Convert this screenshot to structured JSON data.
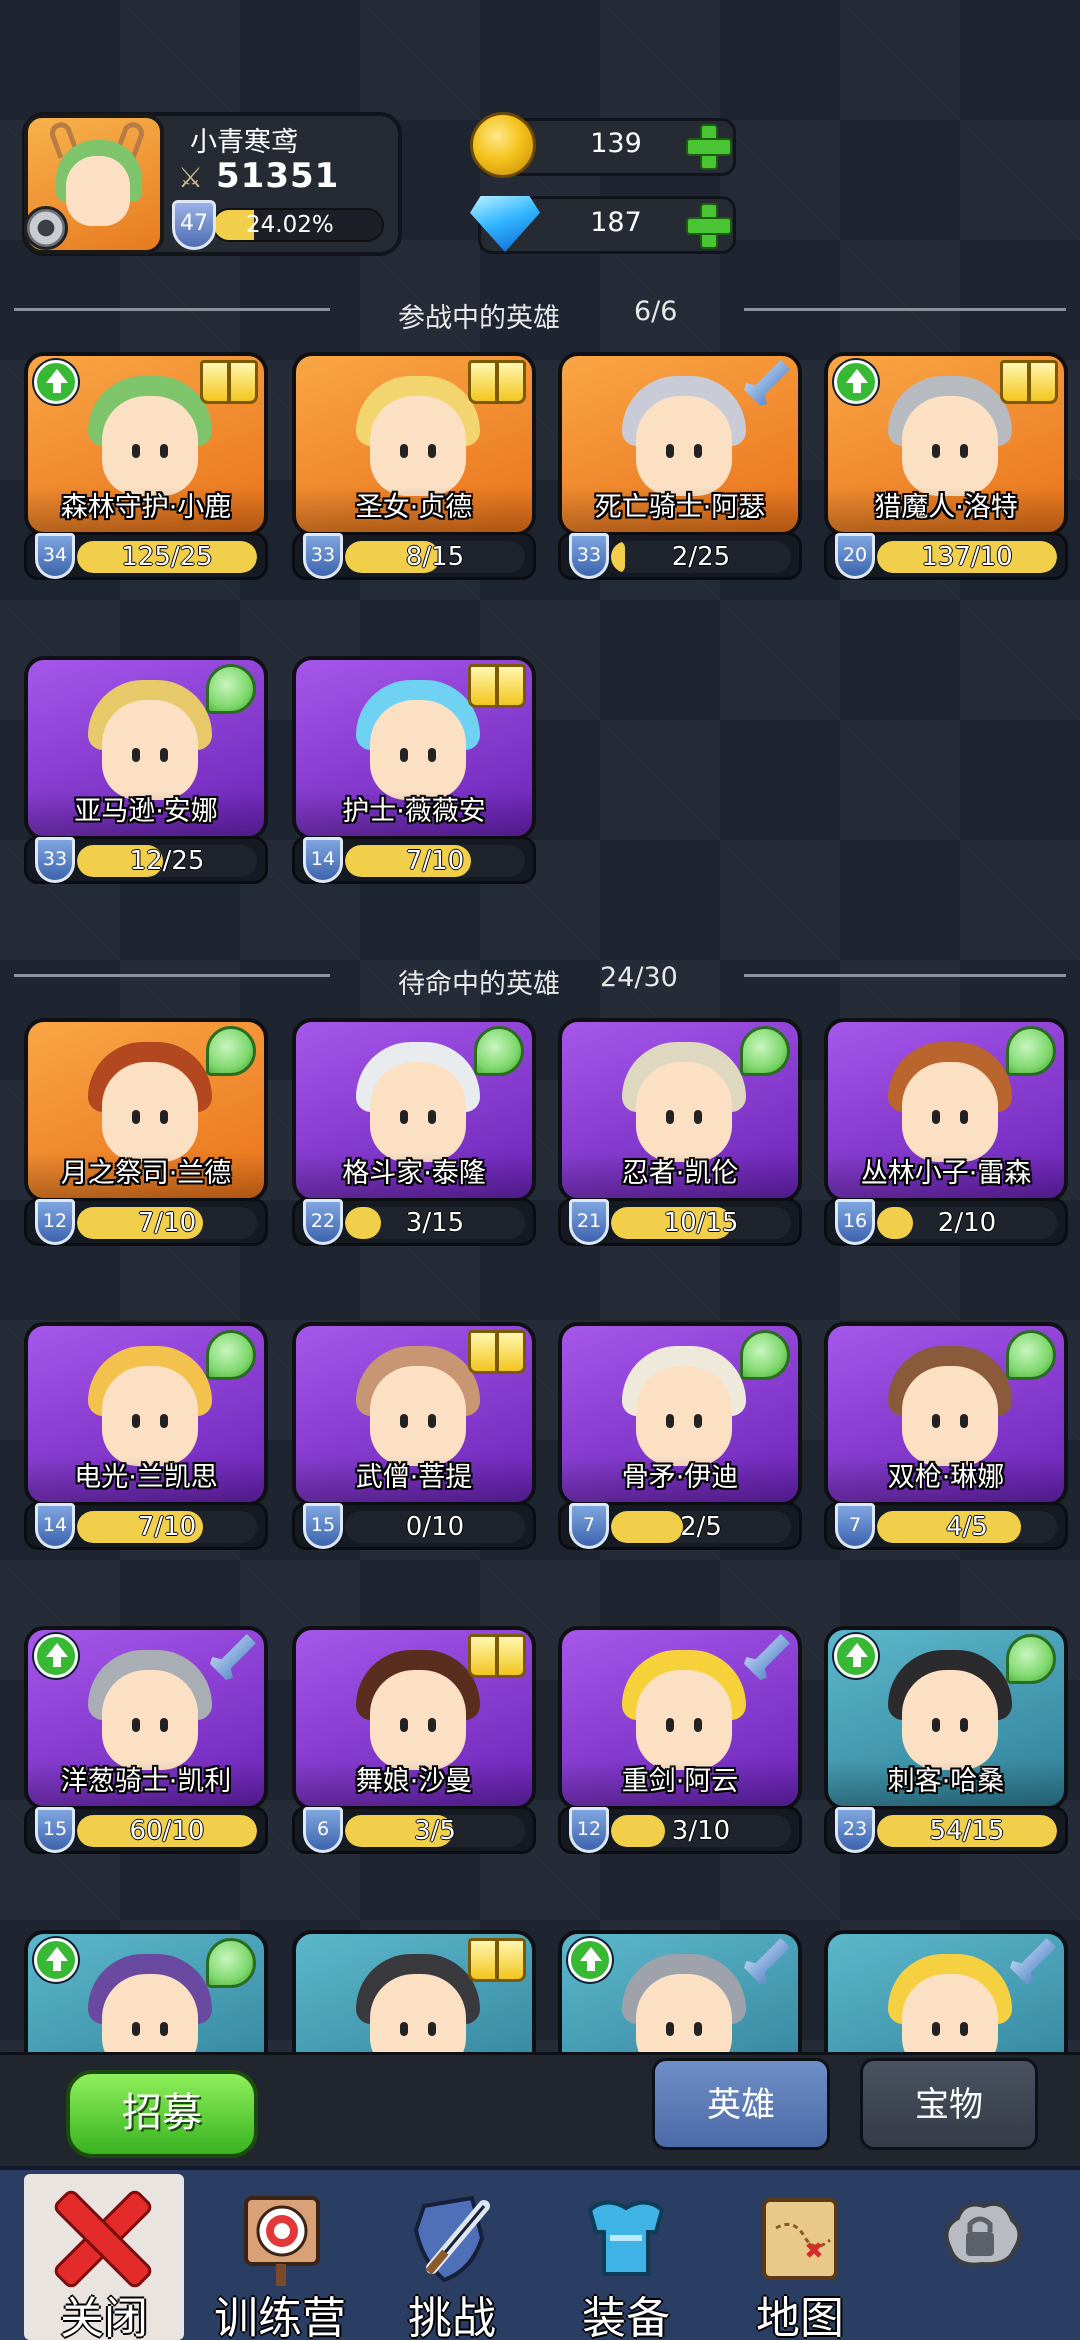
{
  "player": {
    "name": "小青寒鸢",
    "power": "51351",
    "level": "47",
    "xp_text": "24.02%",
    "xp_fraction": 0.2402
  },
  "currencies": {
    "gold": "139",
    "gems": "187"
  },
  "sections": {
    "active_title": "参战中的英雄",
    "active_count": "6/6",
    "reserve_title": "待命中的英雄",
    "reserve_count": "24/30"
  },
  "active_heroes": [
    {
      "name": "森林守护·小鹿",
      "level": "34",
      "progress": "125/25",
      "fill": 1.0,
      "rarity": "orange",
      "badge": "book-icon",
      "upgrade": true,
      "hair": "#7ec46a"
    },
    {
      "name": "圣女·贞德",
      "level": "33",
      "progress": "8/15",
      "fill": 0.53,
      "rarity": "orange",
      "badge": "book-icon",
      "upgrade": false,
      "hair": "#f2d56e"
    },
    {
      "name": "死亡骑士·阿瑟",
      "level": "33",
      "progress": "2/25",
      "fill": 0.08,
      "rarity": "orange",
      "badge": "sword-icon",
      "upgrade": false,
      "hair": "#c9ccd6"
    },
    {
      "name": "猎魔人·洛特",
      "level": "20",
      "progress": "137/10",
      "fill": 1.0,
      "rarity": "orange",
      "badge": "book-icon",
      "upgrade": true,
      "hair": "#b7babf"
    },
    {
      "name": "亚马逊·安娜",
      "level": "33",
      "progress": "12/25",
      "fill": 0.48,
      "rarity": "purple",
      "badge": "leaf-icon",
      "upgrade": false,
      "hair": "#e7c96a"
    },
    {
      "name": "护士·薇薇安",
      "level": "14",
      "progress": "7/10",
      "fill": 0.7,
      "rarity": "purple",
      "badge": "book-icon",
      "upgrade": false,
      "hair": "#6fd2f2"
    }
  ],
  "reserve_heroes": [
    {
      "name": "月之祭司·兰德",
      "level": "12",
      "progress": "7/10",
      "fill": 0.7,
      "rarity": "orange",
      "badge": "leaf-icon",
      "upgrade": false,
      "hair": "#b3471f"
    },
    {
      "name": "格斗家·泰隆",
      "level": "22",
      "progress": "3/15",
      "fill": 0.2,
      "rarity": "purple",
      "badge": "leaf-icon",
      "upgrade": false,
      "hair": "#e9ecef"
    },
    {
      "name": "忍者·凯伦",
      "level": "21",
      "progress": "10/15",
      "fill": 0.67,
      "rarity": "purple",
      "badge": "leaf-icon",
      "upgrade": false,
      "hair": "#ddd8bf"
    },
    {
      "name": "丛林小子·雷森",
      "level": "16",
      "progress": "2/10",
      "fill": 0.2,
      "rarity": "purple",
      "badge": "leaf-icon",
      "upgrade": false,
      "hair": "#b9652d"
    },
    {
      "name": "电光·兰凯思",
      "level": "14",
      "progress": "7/10",
      "fill": 0.7,
      "rarity": "purple",
      "badge": "leaf-icon",
      "upgrade": false,
      "hair": "#f3c24d"
    },
    {
      "name": "武僧·菩提",
      "level": "15",
      "progress": "0/10",
      "fill": 0.0,
      "rarity": "purple",
      "badge": "book-icon",
      "upgrade": false,
      "hair": "#c89673"
    },
    {
      "name": "骨矛·伊迪",
      "level": "7",
      "progress": "2/5",
      "fill": 0.4,
      "rarity": "purple",
      "badge": "leaf-icon",
      "upgrade": false,
      "hair": "#efe9dc"
    },
    {
      "name": "双枪·琳娜",
      "level": "7",
      "progress": "4/5",
      "fill": 0.8,
      "rarity": "purple",
      "badge": "leaf-icon",
      "upgrade": false,
      "hair": "#8a5a3a"
    },
    {
      "name": "洋葱骑士·凯利",
      "level": "15",
      "progress": "60/10",
      "fill": 1.0,
      "rarity": "purple",
      "badge": "sword-icon",
      "upgrade": true,
      "hair": "#a9adb4"
    },
    {
      "name": "舞娘·沙曼",
      "level": "6",
      "progress": "3/5",
      "fill": 0.6,
      "rarity": "purple",
      "badge": "book-icon",
      "upgrade": false,
      "hair": "#5a2e1e"
    },
    {
      "name": "重剑·阿云",
      "level": "12",
      "progress": "3/10",
      "fill": 0.3,
      "rarity": "purple",
      "badge": "sword-icon",
      "upgrade": false,
      "hair": "#f6d13a"
    },
    {
      "name": "刺客·哈桑",
      "level": "23",
      "progress": "54/15",
      "fill": 1.0,
      "rarity": "blue",
      "badge": "leaf-icon",
      "upgrade": true,
      "hair": "#2b2b2e"
    },
    {
      "name": "",
      "level": "",
      "progress": "",
      "fill": 0,
      "rarity": "blue",
      "badge": "leaf-icon",
      "upgrade": true,
      "hair": "#6a4aa0"
    },
    {
      "name": "",
      "level": "",
      "progress": "",
      "fill": 0,
      "rarity": "blue",
      "badge": "book-icon",
      "upgrade": false,
      "hair": "#3a3a3e"
    },
    {
      "name": "",
      "level": "",
      "progress": "",
      "fill": 0,
      "rarity": "blue",
      "badge": "sword-icon",
      "upgrade": true,
      "hair": "#9ea3ab"
    },
    {
      "name": "",
      "level": "",
      "progress": "",
      "fill": 0,
      "rarity": "blue",
      "badge": "sword-icon",
      "upgrade": false,
      "hair": "#f5d142"
    }
  ],
  "actions": {
    "recruit": "招募",
    "tab_heroes": "英雄",
    "tab_treasure": "宝物"
  },
  "nav": [
    {
      "label": "关闭",
      "icon": "close-icon"
    },
    {
      "label": "训练营",
      "icon": "target-icon"
    },
    {
      "label": "挑战",
      "icon": "sword-shield-icon"
    },
    {
      "label": "装备",
      "icon": "armor-icon"
    },
    {
      "label": "地图",
      "icon": "map-icon"
    },
    {
      "label": "",
      "icon": "locked-icon"
    }
  ]
}
